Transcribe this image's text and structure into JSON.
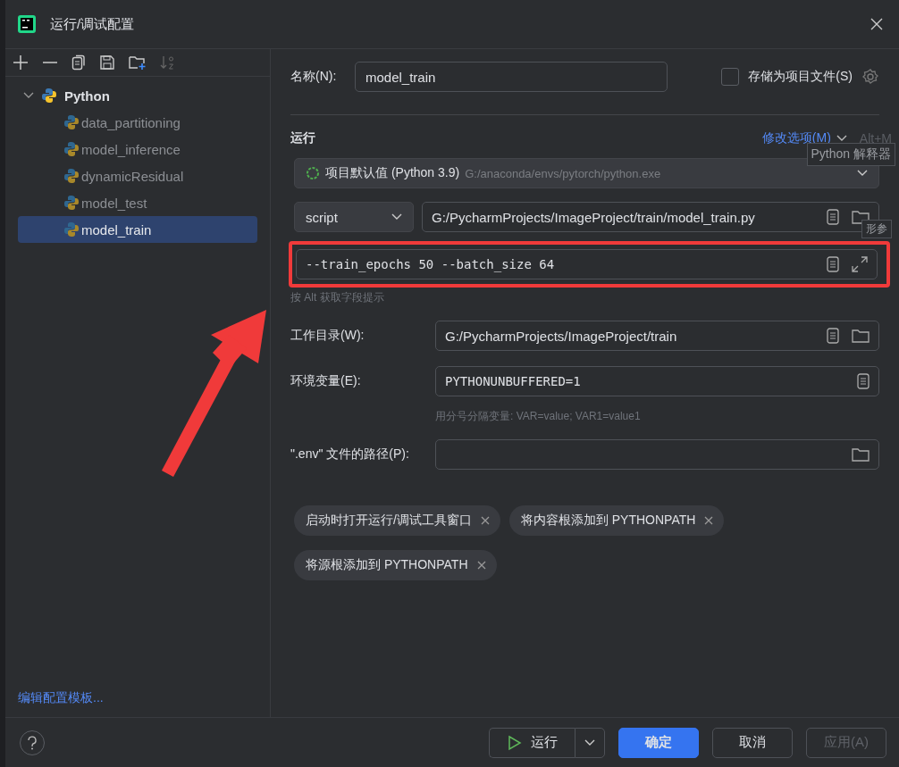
{
  "window": {
    "title": "运行/调试配置"
  },
  "tree": {
    "label": "Python",
    "expanded": true,
    "children": [
      {
        "label": "data_partitioning",
        "selected": false
      },
      {
        "label": "model_inference",
        "selected": false
      },
      {
        "label": "dynamicResidual",
        "selected": false
      },
      {
        "label": "model_test",
        "selected": false
      },
      {
        "label": "model_train",
        "selected": true
      }
    ]
  },
  "edit_templates_link": "编辑配置模板...",
  "name_field": {
    "label": "名称(N):",
    "value": "model_train"
  },
  "store_as_project_file": {
    "label": "存储为项目文件(S)",
    "checked": false
  },
  "run_section": {
    "title": "运行",
    "modify_options_link": "修改选项(M)",
    "shortcut": "Alt+M"
  },
  "interpreter_tooltip": "Python 解释器",
  "interpreter": {
    "name": "项目默认值 (Python 3.9)",
    "path": "G:/anaconda/envs/pytorch/python.exe"
  },
  "script_type": "script",
  "script_path": "G:/PycharmProjects/ImageProject/train/model_train.py",
  "parameters_tooltip": "形参",
  "parameters": {
    "value": "--train_epochs 50 --batch_size 64",
    "highlighted": true
  },
  "field_hint": "按 Alt 获取字段提示",
  "form_rows": [
    {
      "kind": "directory",
      "label": "工作目录(W):",
      "value": "G:/PycharmProjects/ImageProject/train"
    },
    {
      "kind": "env",
      "label": "环境变量(E):",
      "value": "PYTHONUNBUFFERED=1",
      "hint": "用分号分隔变量: VAR=value; VAR1=value1"
    },
    {
      "kind": "file",
      "label": "\".env\" 文件的路径(P):"
    }
  ],
  "option_chips": [
    {
      "label": "启动时打开运行/调试工具窗口"
    },
    {
      "label": "将内容根添加到 PYTHONPATH"
    },
    {
      "label": "将源根添加到 PYTHONPATH"
    }
  ],
  "buttons": {
    "run": "运行",
    "ok": "确定",
    "cancel": "取消",
    "apply": {
      "label": "应用(A)",
      "disabled": true
    }
  }
}
